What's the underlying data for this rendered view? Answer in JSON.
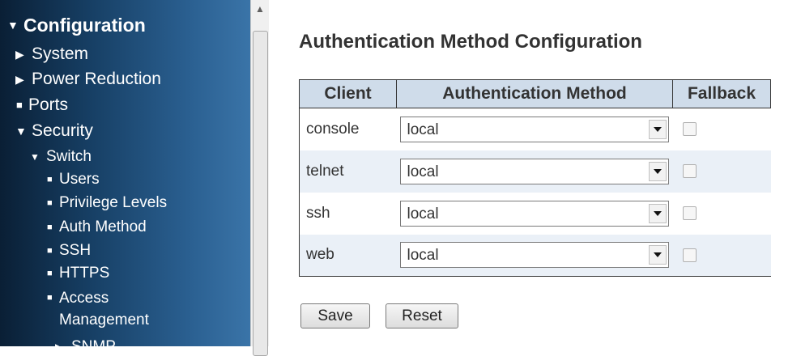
{
  "sidebar": {
    "items": [
      {
        "glyph": "▼",
        "label": "Configuration"
      },
      {
        "glyph": "▶",
        "label": "System"
      },
      {
        "glyph": "▶",
        "label": "Power Reduction"
      },
      {
        "glyph": "■",
        "label": "Ports"
      },
      {
        "glyph": "▼",
        "label": "Security"
      },
      {
        "glyph": "▼",
        "label": "Switch"
      },
      {
        "glyph": "■",
        "label": "Users"
      },
      {
        "glyph": "■",
        "label": "Privilege Levels"
      },
      {
        "glyph": "■",
        "label": "Auth Method"
      },
      {
        "glyph": "■",
        "label": "SSH"
      },
      {
        "glyph": "■",
        "label": "HTTPS"
      },
      {
        "glyph": "■",
        "label": "Access Management"
      },
      {
        "glyph": "▶",
        "label": "SNMP"
      }
    ]
  },
  "main": {
    "title": "Authentication Method Configuration",
    "table": {
      "headers": [
        "Client",
        "Authentication Method",
        "Fallback"
      ],
      "rows": [
        {
          "client": "console",
          "method": "local",
          "fallback": false
        },
        {
          "client": "telnet",
          "method": "local",
          "fallback": false
        },
        {
          "client": "ssh",
          "method": "local",
          "fallback": false
        },
        {
          "client": "web",
          "method": "local",
          "fallback": false
        }
      ]
    },
    "buttons": {
      "save": "Save",
      "reset": "Reset"
    }
  },
  "icons": {
    "scroll_up": "scroll-up-arrow-icon",
    "dropdown": "dropdown-arrow-icon"
  },
  "colors": {
    "sidebar_bg": "#163e63",
    "table_header_bg": "#cfdcea",
    "even_row_bg": "#eaf0f7"
  }
}
